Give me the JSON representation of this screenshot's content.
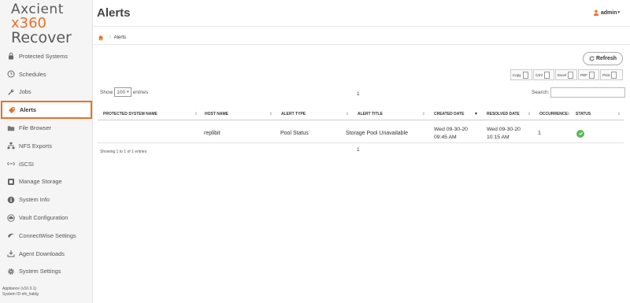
{
  "brand": {
    "line1": "Axcient",
    "line2": "x360",
    "line3": "Recover",
    "accent": "#e8702a"
  },
  "sidebar": {
    "items": [
      {
        "label": "Protected Systems",
        "icon": "lock-icon"
      },
      {
        "label": "Schedules",
        "icon": "clock-icon"
      },
      {
        "label": "Jobs",
        "icon": "wrench-icon"
      },
      {
        "label": "Alerts",
        "icon": "tag-icon"
      },
      {
        "label": "File Browser",
        "icon": "folder-icon"
      },
      {
        "label": "NFS Exports",
        "icon": "network-icon"
      },
      {
        "label": "iSCSI",
        "icon": "iscsi-icon"
      },
      {
        "label": "Manage Storage",
        "icon": "storage-icon"
      },
      {
        "label": "System Info",
        "icon": "info-icon"
      },
      {
        "label": "Vault Configuration",
        "icon": "cloud-icon"
      },
      {
        "label": "ConnectWise Settings",
        "icon": "connectwise-icon"
      },
      {
        "label": "Agent Downloads",
        "icon": "download-icon"
      },
      {
        "label": "System Settings",
        "icon": "gear-icon"
      }
    ],
    "active": "Alerts"
  },
  "footer": {
    "line1": "Appliance (v10.3.1)",
    "line2": "System ID efo_liablg"
  },
  "header": {
    "title": "Alerts",
    "user": "admin"
  },
  "breadcrumb": {
    "current": "Alerts"
  },
  "toolbar": {
    "refresh_label": "Refresh",
    "exports": [
      "Copy",
      "CSV",
      "Excel",
      "PDF",
      "Print"
    ],
    "show_label": "Show",
    "entries_value": "100",
    "entries_label": "entries",
    "search_label": "Search:",
    "page": "1"
  },
  "table": {
    "columns": [
      "PROTECTED SYSTEM NAME",
      "HOST NAME",
      "ALERT TYPE",
      "ALERT TITLE",
      "CREATED DATE",
      "RESOLVED DATE",
      "OCCURRENCE",
      "STATUS"
    ],
    "sorted_column": "CREATED DATE",
    "rows": [
      {
        "protected_system": "",
        "host": "replibit",
        "type": "Pool Status",
        "title": "Storage Pool Unavailable",
        "created_1": "Wed 09-30-20",
        "created_2": "09:45 AM",
        "resolved_1": "Wed 09-30-20",
        "resolved_2": "10:15 AM",
        "occurrence": "1",
        "status": "resolved-check-icon"
      }
    ],
    "info": "Showing 1 to 1 of 1 entries",
    "status_color": "#5cb85c"
  }
}
